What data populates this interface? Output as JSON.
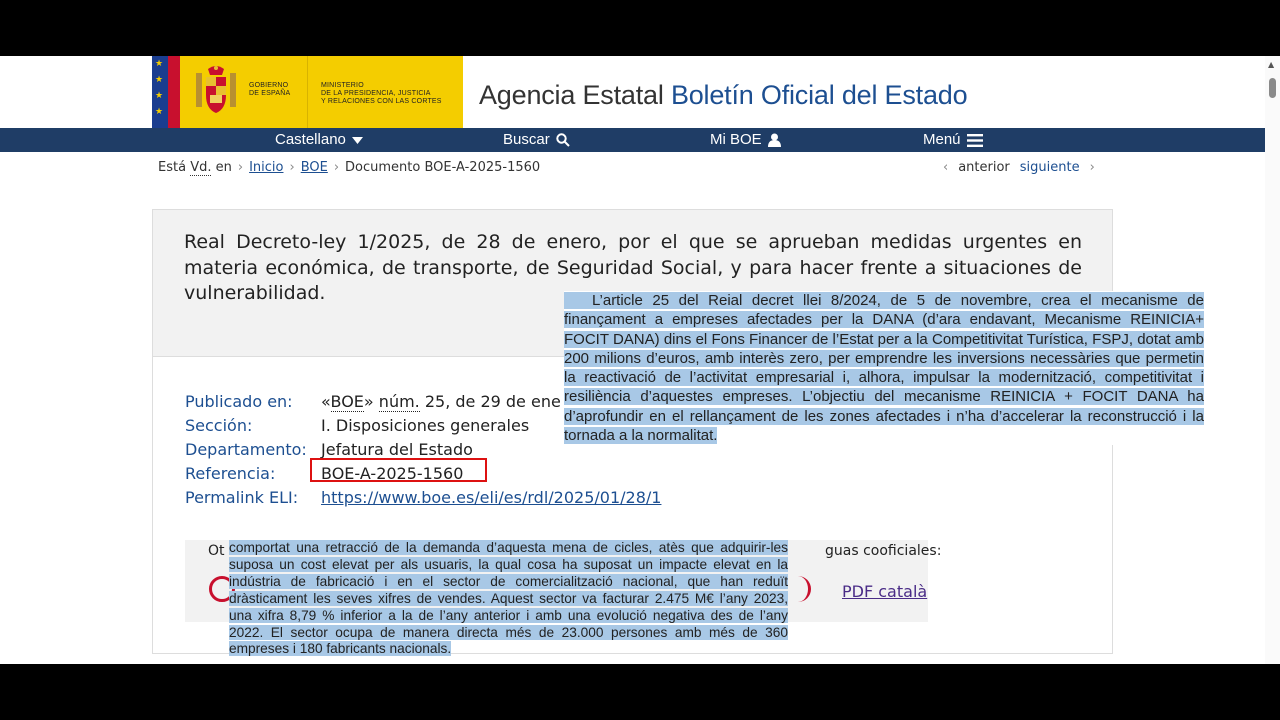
{
  "header": {
    "gov_line1": "GOBIERNO",
    "gov_line2": "DE ESPAÑA",
    "ministry_line1": "MINISTERIO",
    "ministry_line2": "DE LA PRESIDENCIA, JUSTICIA",
    "ministry_line3": "Y RELACIONES CON LAS CORTES",
    "site_title_part1": "Agencia Estatal",
    "site_title_part2": "Boletín Oficial del Estado"
  },
  "nav": {
    "language": "Castellano",
    "search": "Buscar",
    "mi_boe": "Mi BOE",
    "menu": "Menú"
  },
  "breadcrumb": {
    "prefix": "Está",
    "prefix_abbr": "Vd.",
    "prefix_suffix": "en",
    "items": [
      "Inicio",
      "BOE"
    ],
    "current": "Documento BOE-A-2025-1560",
    "prev": "anterior",
    "next": "siguiente"
  },
  "document": {
    "title": "Real Decreto-ley 1/2025, de 28 de enero, por el que se aprueban medidas urgentes en materia económica, de transporte, de Seguridad Social, y para hacer frente a situaciones de vulnerabilidad.",
    "meta": {
      "publicado_label": "Publicado en:",
      "publicado_value_pre": "«",
      "publicado_value_boe": "BOE",
      "publicado_value_mid": "» ",
      "publicado_value_num": "núm.",
      "publicado_value_post": " 25, de 29 de ene",
      "seccion_label": "Sección:",
      "seccion_value": "I. Disposiciones generales",
      "departamento_label": "Departamento:",
      "departamento_value": "Jefatura del Estado",
      "referencia_label": "Referencia:",
      "referencia_value": "BOE-A-2025-1560",
      "permalink_label": "Permalink ELI:",
      "permalink_value": "https://www.boe.es/eli/es/rdl/2025/01/28/1"
    },
    "other_formats_label": "Ot",
    "cooficiales_label": "guas cooficiales:",
    "pdf_catala": "PDF català"
  },
  "overlay_text_1": "L’article 25 del Reial decret llei 8/2024, de 5 de novembre, crea el mecanisme de finançament a empreses afectades per la DANA (d’ara endavant, Mecanisme REINICIA+ FOCIT DANA) dins el Fons Financer de l’Estat per a la Competitivitat Turística, FSPJ, dotat amb 200 milions d’euros, amb interès zero, per emprendre les inversions necessàries que permetin la reactivació de l’activitat empresarial i, alhora, impulsar la modernització, competitivitat i resiliència d’aquestes empreses. L’objectiu del mecanisme REINICIA + FOCIT DANA ha d’aprofundir en el rellançament de les zones afectades i n’ha d’accelerar la reconstrucció i la tornada a la normalitat.",
  "overlay_text_2": "comportat una retracció de la demanda d’aquesta mena de cicles, atès que adquirir-les suposa un cost elevat per als usuaris, la qual cosa ha suposat un impacte elevat en la indústria de fabricació i en el sector de comercialització nacional, que han reduït dràsticament les seves xifres de vendes. Aquest sector va facturar 2.475 M€ l’any 2023, una xifra 8,79 % inferior a la de l’any anterior i amb una evolució negativa des de l’any 2022. El sector ocupa de manera directa més de 23.000 persones amb més de 360 empreses i 180 fabricants nacionals.",
  "colors": {
    "nav_bg": "#1f3d66",
    "brand_yellow": "#f4cd00",
    "link_blue": "#1d4f91",
    "highlight": "#a8c8e6",
    "ref_box_red": "#d11111"
  }
}
